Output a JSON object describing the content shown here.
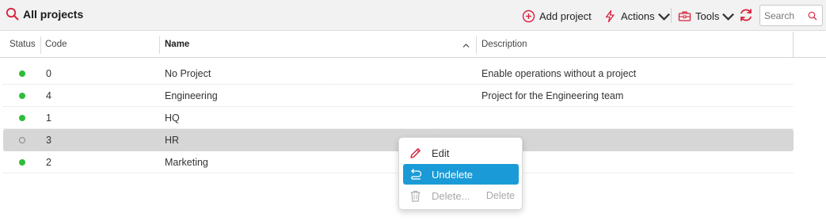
{
  "toolbar": {
    "title": "All projects",
    "add_label": "Add project",
    "actions_label": "Actions",
    "tools_label": "Tools",
    "search_placeholder": "Search"
  },
  "colors": {
    "accent_red": "#d9213c",
    "active_dot": "#2ebd3a",
    "menu_highlight": "#1a9bd7"
  },
  "columns": {
    "status": "Status",
    "code": "Code",
    "name": "Name",
    "description": "Description"
  },
  "rows": [
    {
      "status": "active",
      "code": "0",
      "name": "No Project",
      "description": "Enable operations without a project"
    },
    {
      "status": "active",
      "code": "4",
      "name": "Engineering",
      "description": "Project for the Engineering team"
    },
    {
      "status": "active",
      "code": "1",
      "name": "HQ",
      "description": ""
    },
    {
      "status": "deleted",
      "code": "3",
      "name": "HR",
      "description": ""
    },
    {
      "status": "active",
      "code": "2",
      "name": "Marketing",
      "description": ""
    }
  ],
  "context_menu": {
    "edit": "Edit",
    "undelete": "Undelete",
    "delete": "Delete...",
    "delete_shortcut": "Delete"
  }
}
